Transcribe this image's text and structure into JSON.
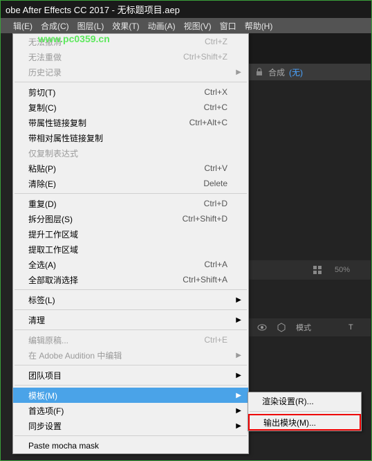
{
  "titlebar": "obe After Effects CC 2017 - 无标题项目.aep",
  "watermark": "www.pc0359.cn",
  "menubar": [
    "辑(E)",
    "合成(C)",
    "图层(L)",
    "效果(T)",
    "动画(A)",
    "视图(V)",
    "窗口",
    "帮助(H)"
  ],
  "comp_row": {
    "label": "合成",
    "value": "(无)"
  },
  "mid_row": {
    "zoom": "50%"
  },
  "footer_row": {
    "mode": "模式",
    "t": "T"
  },
  "menu": [
    {
      "type": "item",
      "label": "无法撤消",
      "shortcut": "Ctrl+Z",
      "disabled": true
    },
    {
      "type": "item",
      "label": "无法重做",
      "shortcut": "Ctrl+Shift+Z",
      "disabled": true
    },
    {
      "type": "sub",
      "label": "历史记录",
      "disabled": true
    },
    {
      "type": "sep"
    },
    {
      "type": "item",
      "label": "剪切(T)",
      "shortcut": "Ctrl+X"
    },
    {
      "type": "item",
      "label": "复制(C)",
      "shortcut": "Ctrl+C"
    },
    {
      "type": "item",
      "label": "带属性链接复制",
      "shortcut": "Ctrl+Alt+C"
    },
    {
      "type": "item",
      "label": "带相对属性链接复制"
    },
    {
      "type": "item",
      "label": "仅复制表达式",
      "disabled": true
    },
    {
      "type": "item",
      "label": "粘贴(P)",
      "shortcut": "Ctrl+V"
    },
    {
      "type": "item",
      "label": "清除(E)",
      "shortcut": "Delete"
    },
    {
      "type": "sep"
    },
    {
      "type": "item",
      "label": "重复(D)",
      "shortcut": "Ctrl+D"
    },
    {
      "type": "item",
      "label": "拆分图层(S)",
      "shortcut": "Ctrl+Shift+D"
    },
    {
      "type": "item",
      "label": "提升工作区域"
    },
    {
      "type": "item",
      "label": "提取工作区域"
    },
    {
      "type": "item",
      "label": "全选(A)",
      "shortcut": "Ctrl+A"
    },
    {
      "type": "item",
      "label": "全部取消选择",
      "shortcut": "Ctrl+Shift+A"
    },
    {
      "type": "sep"
    },
    {
      "type": "sub",
      "label": "标签(L)"
    },
    {
      "type": "sep"
    },
    {
      "type": "sub",
      "label": "清理"
    },
    {
      "type": "sep"
    },
    {
      "type": "item",
      "label": "编辑原稿...",
      "shortcut": "Ctrl+E",
      "disabled": true
    },
    {
      "type": "sub",
      "label": "在 Adobe Audition 中编辑",
      "disabled": true
    },
    {
      "type": "sep"
    },
    {
      "type": "sub",
      "label": "团队项目"
    },
    {
      "type": "sep"
    },
    {
      "type": "sub",
      "label": "模板(M)",
      "highlighted": true
    },
    {
      "type": "sub",
      "label": "首选项(F)"
    },
    {
      "type": "sub",
      "label": "同步设置"
    },
    {
      "type": "sep"
    },
    {
      "type": "item",
      "label": "Paste mocha mask"
    }
  ],
  "submenu": [
    {
      "label": "渲染设置(R)..."
    },
    {
      "label": "输出模块(M)...",
      "boxed": true
    }
  ]
}
